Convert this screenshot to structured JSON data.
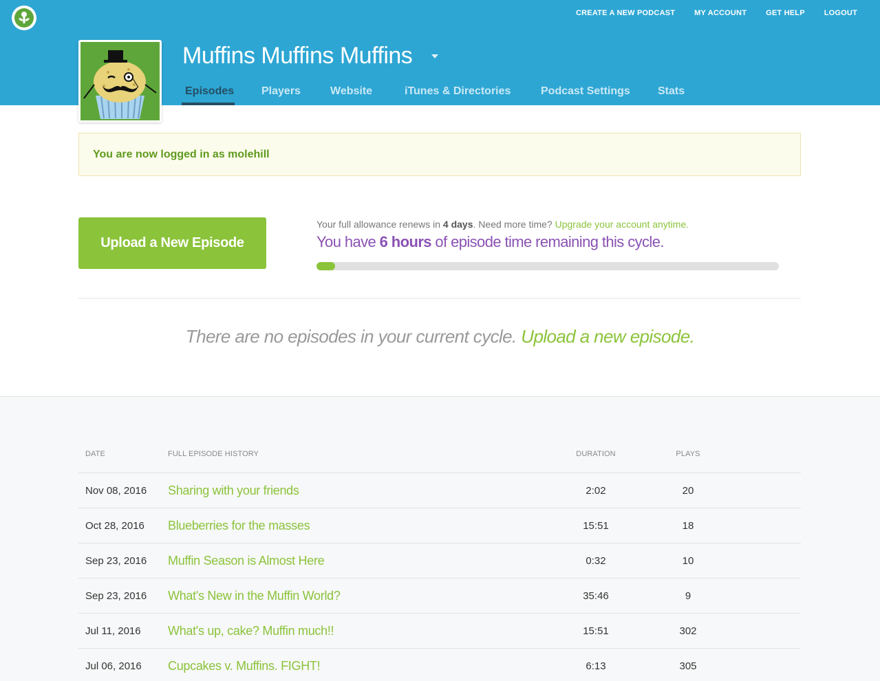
{
  "topnav": [
    {
      "label": "CREATE A NEW PODCAST"
    },
    {
      "label": "MY ACCOUNT"
    },
    {
      "label": "GET HELP"
    },
    {
      "label": "LOGOUT"
    }
  ],
  "podcast": {
    "title": "Muffins Muffins Muffins"
  },
  "tabs": [
    {
      "label": "Episodes"
    },
    {
      "label": "Players"
    },
    {
      "label": "Website"
    },
    {
      "label": "iTunes & Directories"
    },
    {
      "label": "Podcast Settings"
    },
    {
      "label": "Stats"
    }
  ],
  "alert": {
    "message": "You are now logged in as molehill"
  },
  "upload": {
    "button_label": "Upload a New Episode"
  },
  "allowance": {
    "prefix": "Your full allowance renews in ",
    "days": "4 days",
    "middle": ". Need more time? ",
    "link": "Upgrade your account anytime.",
    "remaining_prefix": "You have ",
    "remaining_hours": "6 hours",
    "remaining_suffix": " of episode time remaining this cycle.",
    "progress_fraction": 0.04
  },
  "empty": {
    "message": "There are no episodes in your current cycle. ",
    "link": "Upload a new episode."
  },
  "history": {
    "headers": {
      "date": "DATE",
      "title": "FULL EPISODE HISTORY",
      "duration": "DURATION",
      "plays": "PLAYS"
    },
    "rows": [
      {
        "date": "Nov 08, 2016",
        "title": "Sharing with your friends",
        "duration": "2:02",
        "plays": "20"
      },
      {
        "date": "Oct 28, 2016",
        "title": "Blueberries for the masses",
        "duration": "15:51",
        "plays": "18"
      },
      {
        "date": "Sep 23, 2016",
        "title": "Muffin Season is Almost Here",
        "duration": "0:32",
        "plays": "10"
      },
      {
        "date": "Sep 23, 2016",
        "title": "What's New in the Muffin World?",
        "duration": "35:46",
        "plays": "9"
      },
      {
        "date": "Jul 11, 2016",
        "title": "What's up, cake? Muffin much!!",
        "duration": "15:51",
        "plays": "302"
      },
      {
        "date": "Jul 06, 2016",
        "title": "Cupcakes v. Muffins. FIGHT!",
        "duration": "6:13",
        "plays": "305"
      }
    ]
  },
  "colors": {
    "header": "#2da6d4",
    "accent_green": "#8bc33a",
    "purple": "#8a52b4",
    "tab_active": "#244e63"
  }
}
